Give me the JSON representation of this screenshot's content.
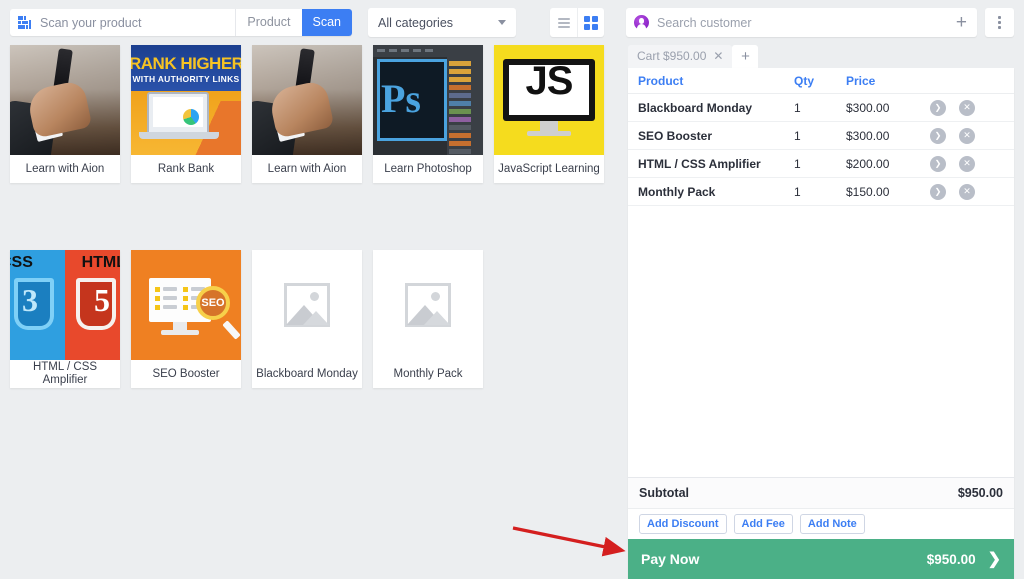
{
  "toolbar": {
    "scan_icon": "barcode-scanner-icon",
    "scan_placeholder": "Scan your product",
    "scan_value": "",
    "segment_product": "Product",
    "segment_scan": "Scan",
    "category_selected": "All categories",
    "category_caret_icon": "chevron-down-icon",
    "view_list_icon": "list-view-icon",
    "view_grid_icon": "grid-view-icon"
  },
  "products": [
    {
      "name": "Learn with Aion",
      "art": "aion"
    },
    {
      "name": "Rank Bank",
      "art": "rank",
      "art_title": "RANK HIGHER",
      "art_subtitle": "WITH AUTHORITY LINKS"
    },
    {
      "name": "Learn with Aion",
      "art": "aion"
    },
    {
      "name": "Learn Photoshop",
      "art": "ps",
      "art_text": "Ps"
    },
    {
      "name": "JavaScript Learning",
      "art": "js",
      "art_text": "JS"
    },
    {
      "name": "HTML / CSS Amplifier",
      "art": "html",
      "art_left_label": "CSS",
      "art_right_label": "HTML",
      "art_left_num": "3",
      "art_right_num": "5"
    },
    {
      "name": "SEO Booster",
      "art": "seo",
      "art_text": "SEO"
    },
    {
      "name": "Blackboard Monday",
      "art": "placeholder"
    },
    {
      "name": "Monthly Pack",
      "art": "placeholder"
    }
  ],
  "customer": {
    "avatar_icon": "user-avatar-icon",
    "placeholder": "Search customer",
    "value": "",
    "add_icon": "plus-icon",
    "menu_icon": "kebab-menu-icon"
  },
  "cart_tabs": {
    "active_label": "Cart $950.00",
    "close_icon": "close-icon",
    "add_tab_icon": "plus-icon"
  },
  "cart_table": {
    "headers": {
      "product": "Product",
      "qty": "Qty",
      "price": "Price"
    },
    "rows": [
      {
        "product": "Blackboard Monday",
        "qty": "1",
        "price": "$300.00"
      },
      {
        "product": "SEO Booster",
        "qty": "1",
        "price": "$300.00"
      },
      {
        "product": "HTML / CSS Amplifier",
        "qty": "1",
        "price": "$200.00"
      },
      {
        "product": "Monthly Pack",
        "qty": "1",
        "price": "$150.00"
      }
    ],
    "row_expand_icon": "chevron-right-icon",
    "row_remove_icon": "remove-circle-icon"
  },
  "summary": {
    "subtotal_label": "Subtotal",
    "subtotal_value": "$950.00",
    "add_discount": "Add Discount",
    "add_fee": "Add Fee",
    "add_note": "Add Note"
  },
  "pay": {
    "label": "Pay Now",
    "amount": "$950.00",
    "arrow_icon": "chevron-right-icon"
  },
  "colors": {
    "accent_blue": "#3c7ef3",
    "pay_green": "#4bb087",
    "background": "#eceef0",
    "avatar_purple": "#8e27c9",
    "annotation_red": "#d41f1f"
  }
}
